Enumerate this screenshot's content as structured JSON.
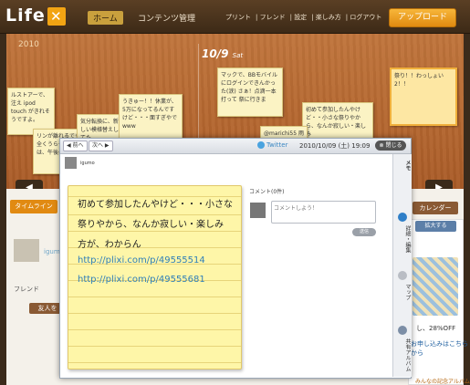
{
  "app": {
    "logo_text": "Life",
    "logo_mark": "✕",
    "nav_home": "ホーム",
    "nav_contents": "コンテンツ管理",
    "nav_links": [
      "プリント",
      "フレンド",
      "設定",
      "楽しみ方",
      "ログアウト"
    ],
    "upload_label": "アップロード"
  },
  "timeline": {
    "year": "2010",
    "date": "10/9",
    "day": "Sat",
    "notes": [
      "ルストアーで、注え ipod touch がきれそうですよ。",
      "リンが離れるでもう全くうらやましい日は、午後にあもな",
      "気分転換に、新しい模様替えしてた",
      "うきゅー！！休業が、5万になってるんですけど・・・面すぎやでwww",
      "マックで、BBモバイルにログインできんかった(涙) さぁ！点滴一本打って 祭に行きま",
      "初めて参加したんやけど・・小さな祭りやから、なんか寂しい・楽しみ",
      "@marichi55 雨に",
      "祭り！！わっしょい2！！"
    ],
    "prev_arrow": "◀",
    "next_arrow": "▶"
  },
  "below": {
    "tab_timeline": "タイムライン",
    "tab_calendar": "カレンダー",
    "user_name": "igum",
    "friend_label": "フレンド",
    "friend_button": "友人を",
    "enlarge_button": "拡大する",
    "ad_discount": "し、28%OFF",
    "ad_link": "お申し込みはこちらから",
    "ad_bottom": "みんなの記念アルバム"
  },
  "modal": {
    "prev": "前へ",
    "next": "次へ",
    "source": "Twitter",
    "posted_at": "2010/10/09 (土) 19:09",
    "close": "閉じる",
    "user": "igumo",
    "note_lines": [
      "初めて参加したんやけど・・・小さな",
      "祭りやから、なんか寂しい・楽しみ",
      "方が、わからん"
    ],
    "links": [
      "http://plixi.com/p/49555514",
      "http://plixi.com/p/49555681"
    ],
    "comment_label": "コメント(0件)",
    "comment_placeholder": "コメントしよう！",
    "send_label": "送信",
    "side_tabs": [
      "メモ",
      "詳細・編集",
      "マップ",
      "共有アルバム"
    ]
  },
  "colors": {
    "accent": "#e18a12",
    "link": "#2f7fb8",
    "note_yellow": "#fef6a8"
  }
}
